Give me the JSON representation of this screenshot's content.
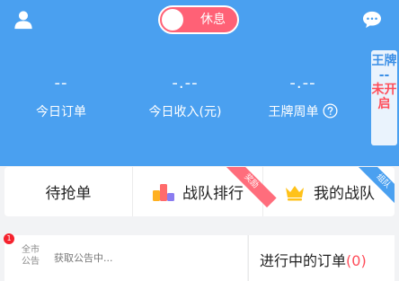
{
  "header": {
    "status_toggle": {
      "label": "休息",
      "on": false
    },
    "icons": {
      "user": "user-icon",
      "chat": "chat-bubble-icon",
      "help": "help-circle-icon"
    },
    "stats": [
      {
        "value": "--",
        "label": "今日订单"
      },
      {
        "value": "-.--",
        "label": "今日收入(元)"
      },
      {
        "value": "-.--",
        "label": "王牌周单"
      }
    ],
    "side_tag": {
      "line1": "王牌",
      "sep": "--",
      "line2": "未开启"
    }
  },
  "tabs": [
    {
      "label": "待抢单"
    },
    {
      "label": "战队排行",
      "icon": "blocks-icon",
      "ribbon": "奖励"
    },
    {
      "label": "我的战队",
      "icon": "crown-icon",
      "ribbon": "组队"
    }
  ],
  "notice": {
    "badge": "1",
    "tag": "全市公告",
    "text": "获取公告中..."
  },
  "orders": {
    "title": "进行中的订单",
    "count": "(0)"
  },
  "colors": {
    "primary_blue": "#4aa0f0",
    "toggle_red": "#ff6176",
    "alert_red": "#ff4d5a",
    "crown_yellow": "#ffc21a"
  }
}
